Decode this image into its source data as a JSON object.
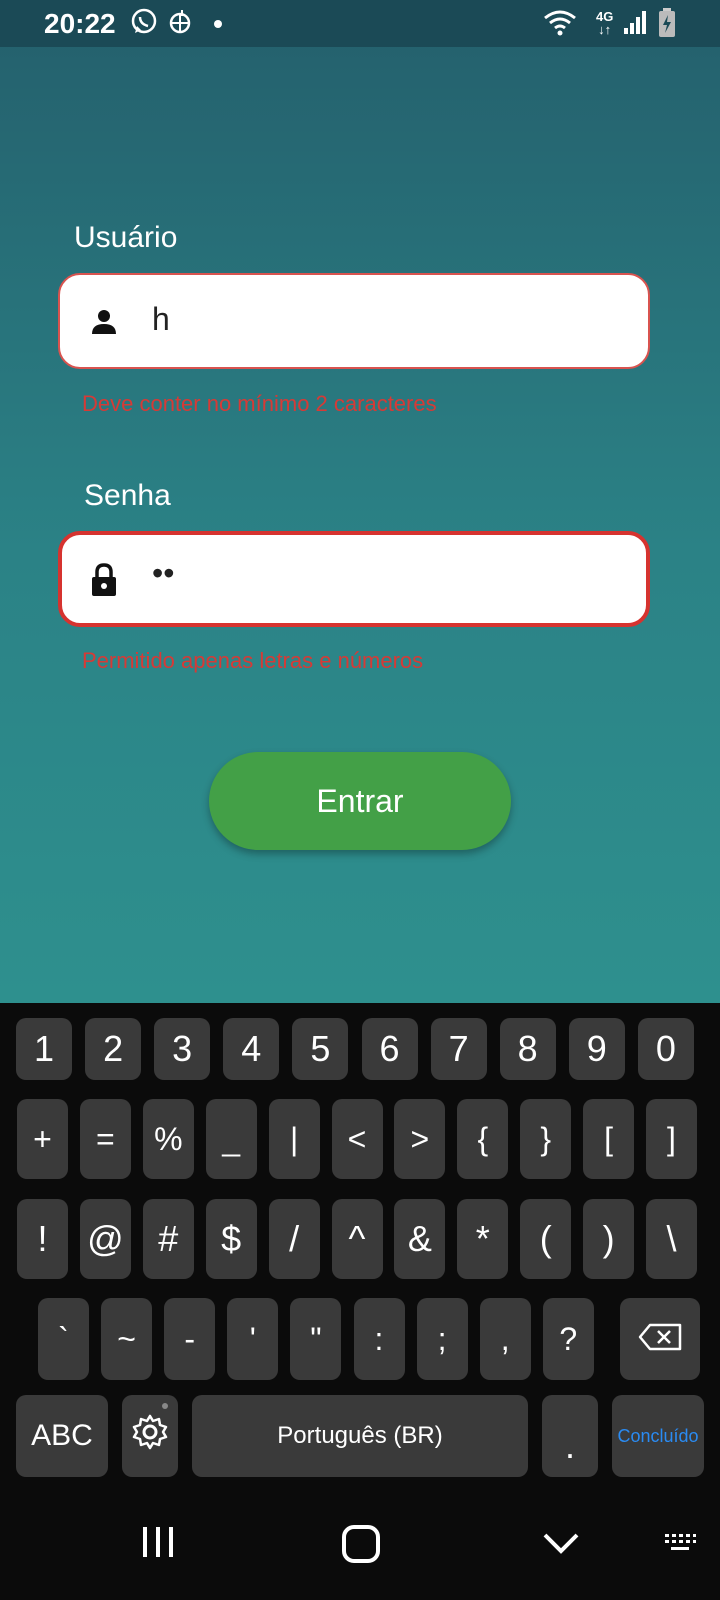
{
  "status_bar": {
    "time": "20:22",
    "network": "4G"
  },
  "login": {
    "username_label": "Usuário",
    "username_value": "h",
    "username_error": "Deve conter no mínimo 2 caracteres",
    "password_label": "Senha",
    "password_value": "••",
    "password_error": "Permitido apenas letras e números",
    "submit_label": "Entrar"
  },
  "colors": {
    "accent_button": "#43a047",
    "error": "#d63a36",
    "background_top": "#245f6c",
    "background_bottom": "#2e908e"
  },
  "keyboard": {
    "row1": [
      "1",
      "2",
      "3",
      "4",
      "5",
      "6",
      "7",
      "8",
      "9",
      "0"
    ],
    "row2": [
      "+",
      "=",
      "%",
      "_",
      "|",
      "<",
      ">",
      "{",
      "}",
      "[",
      "]"
    ],
    "row3": [
      "!",
      "@",
      "#",
      "$",
      "/",
      "^",
      "&",
      "*",
      "(",
      ")",
      "\\"
    ],
    "row4": [
      "`",
      "~",
      "-",
      "'",
      "\"",
      ":",
      ";",
      ",",
      "?"
    ],
    "abc_label": "ABC",
    "space_label": "Português (BR)",
    "period_label": ".",
    "done_label": "Concluído"
  }
}
